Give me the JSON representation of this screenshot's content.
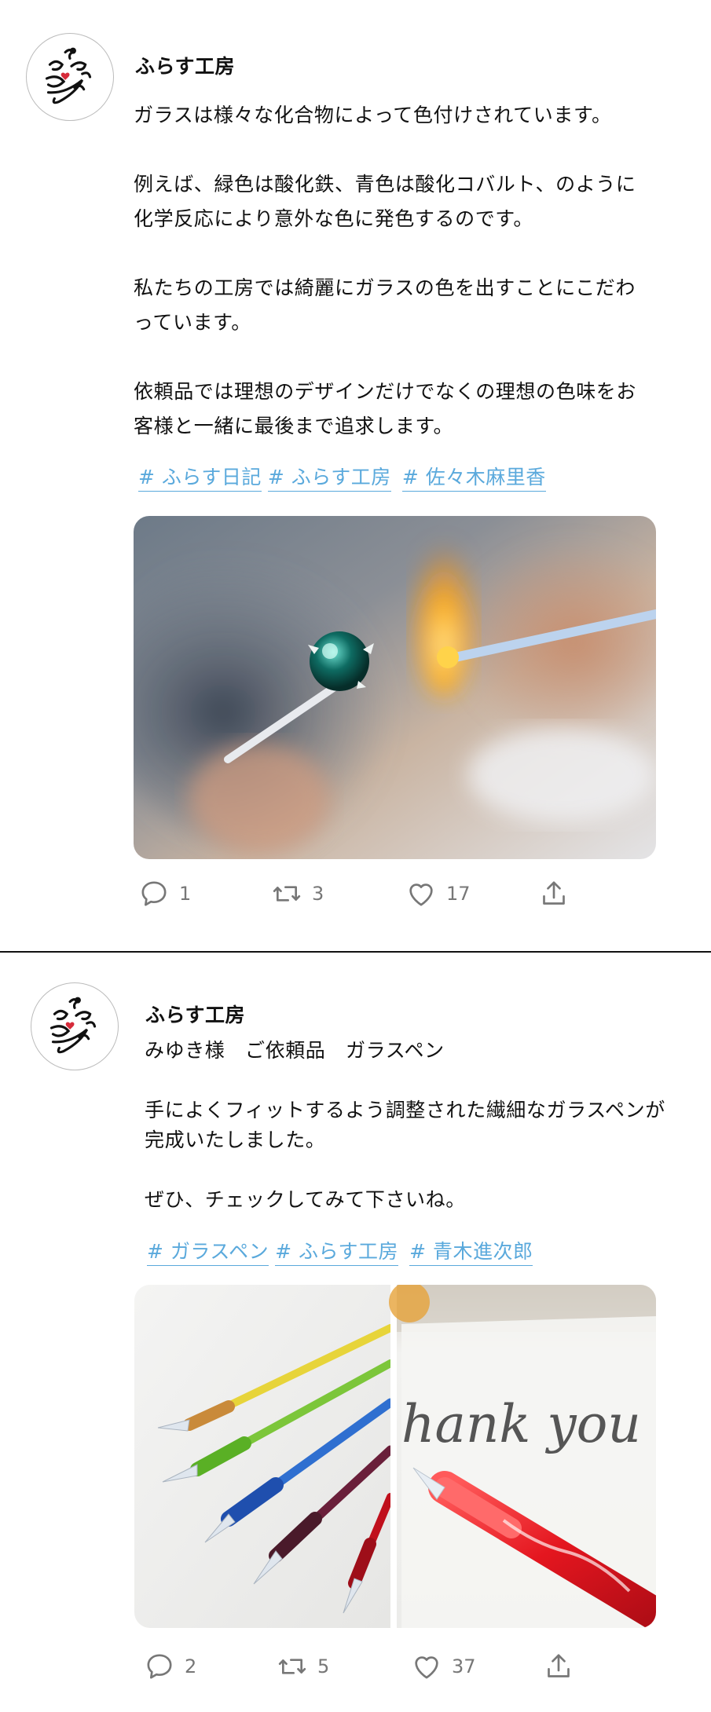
{
  "posts": [
    {
      "author": "ふらす工房",
      "body": "ガラスは様々な化合物によって色付けされています。\n\n例えば、緑色は酸化鉄、青色は酸化コバルト、のように\n化学反応により意外な色に発色するのです。\n\n私たちの工房では綺麗にガラスの色を出すことにこだわ\nっています。\n\n依頼品では理想のデザインだけでなくの理想の色味をお\n客様と一緒に最後まで追求します。",
      "tags": [
        "# ふらす日記",
        "# ふらす工房",
        "# 佐々木麻里香"
      ],
      "replies": "1",
      "retweets": "3",
      "likes": "17"
    },
    {
      "author": "ふらす工房",
      "body": "みゆき様　ご依頼品　ガラスペン\n\n手によくフィットするよう調整された繊細なガラスペンが\n完成いたしました。\n\nぜひ、チェックしてみて下さいね。",
      "tags": [
        "# ガラスペン",
        "# ふらす工房",
        "# 青木進次郎"
      ],
      "replies": "2",
      "retweets": "5",
      "likes": "37"
    }
  ],
  "thank_you_text": "hank you",
  "icons": [
    "reply-icon",
    "retweet-icon",
    "like-icon",
    "share-icon"
  ],
  "colors": {
    "tag": "#5aa9dc",
    "count": "#777777",
    "heart": "#d62b3a"
  }
}
